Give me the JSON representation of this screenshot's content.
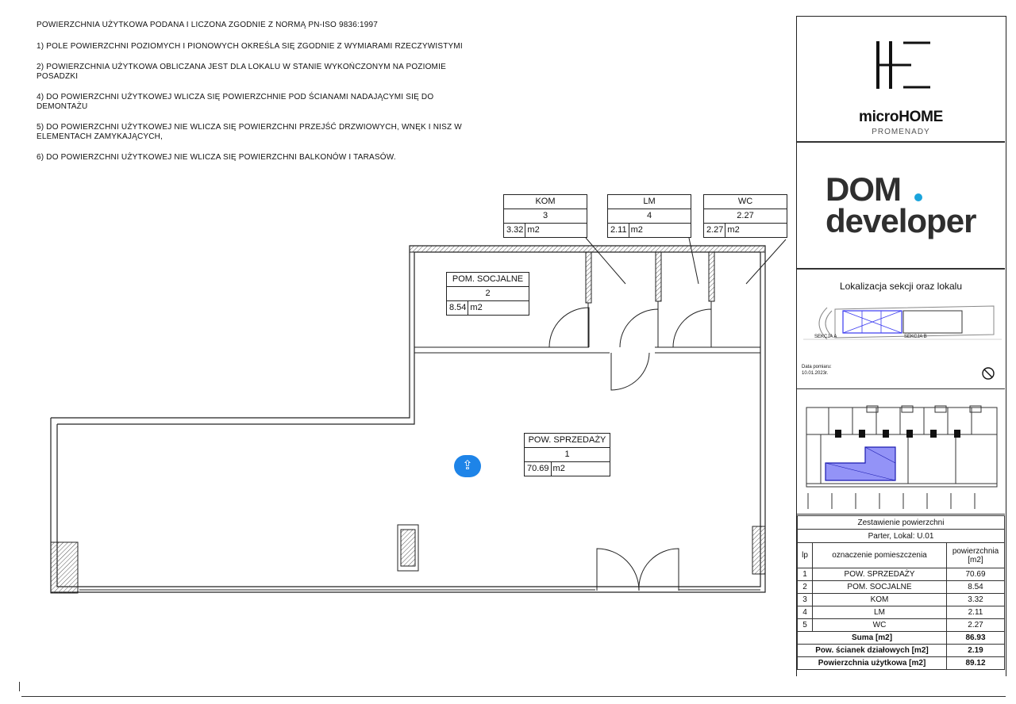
{
  "notes": {
    "title": "POWIERZCHNIA UŻYTKOWA PODANA I LICZONA ZGODNIE Z NORMĄ PN-ISO 9836:1997",
    "items": [
      "1) POLE POWIERZCHNI POZIOMYCH I PIONOWYCH OKREŚLA SIĘ ZGODNIE Z  WYMIARAMI RZECZYWISTYMI",
      "2) POWIERZCHNIA UŻYTKOWA OBLICZANA JEST DLA LOKALU W STANIE  WYKOŃCZONYM NA POZIOMIE POSADZKI",
      "4) DO POWIERZCHNI UŻYTKOWEJ WLICZA SIĘ POWIERZCHNIE POD ŚCIANAMI NADAJĄCYMI SIĘ DO DEMONTAŻU",
      "5) DO POWIERZCHNI UŻYTKOWEJ NIE WLICZA SIĘ POWIERZCHNI PRZEJŚĆ  DRZWIOWYCH, WNĘK I NISZ W ELEMENTACH ZAMYKAJĄCYCH,",
      "6) DO POWIERZCHNI UŻYTKOWEJ NIE WLICZA SIĘ POWIERZCHNI  BALKONÓW I TARASÓW."
    ]
  },
  "brand": {
    "name": "microHOME",
    "sub": "PROMENADY",
    "developer_line1": "DOM",
    "developer_line2": "developer"
  },
  "location": {
    "title": "Lokalizacja sekcji oraz lokalu",
    "section_a": "SEKCJA A",
    "section_b": "SEKCJA B",
    "date_label": "Data pomiaru:",
    "date_value": "10.01.2023r."
  },
  "rooms": [
    {
      "name": "KOM",
      "num": "3",
      "area": "3.32",
      "unit": "m2"
    },
    {
      "name": "LM",
      "num": "4",
      "area": "2.11",
      "unit": "m2"
    },
    {
      "name": "WC",
      "num": "2.27",
      "area": "2.27",
      "unit": "m2"
    },
    {
      "name": "POM. SOCJALNE",
      "num": "2",
      "area": "8.54",
      "unit": "m2"
    },
    {
      "name": "POW. SPRZEDAŻY",
      "num": "1",
      "area": "70.69",
      "unit": "m2"
    }
  ],
  "summary": {
    "title": "Zestawienie powierzchni",
    "subtitle": "Parter, Lokal: U.01",
    "col_lp": "lp",
    "col_name": "oznaczenie pomieszczenia",
    "col_area": "powierzchnia [m2]",
    "rows": [
      {
        "lp": "1",
        "name": "POW. SPRZEDAŻY",
        "area": "70.69"
      },
      {
        "lp": "2",
        "name": "POM. SOCJALNE",
        "area": "8.54"
      },
      {
        "lp": "3",
        "name": "KOM",
        "area": "3.32"
      },
      {
        "lp": "4",
        "name": "LM",
        "area": "2.11"
      },
      {
        "lp": "5",
        "name": "WC",
        "area": "2.27"
      }
    ],
    "sum_label": "Suma [m2]",
    "sum_value": "86.93",
    "walls_label": "Pow. ścianek działowych [m2]",
    "walls_value": "2.19",
    "usable_label": "Powierzchnia użytkowa [m2]",
    "usable_value": "89.12"
  },
  "colors": {
    "accent": "#1e84e8",
    "dom_dot": "#1aa4dc",
    "highlight": "#3a3af0"
  }
}
